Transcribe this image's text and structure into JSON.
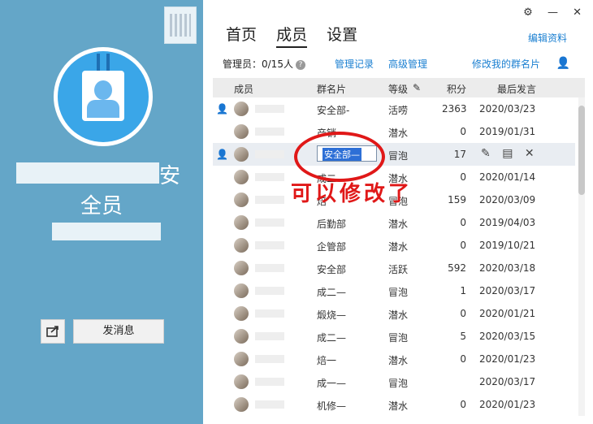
{
  "sidebar": {
    "group_name_visible_part": "安",
    "group_role": "全员",
    "send_message_label": "发消息"
  },
  "window": {
    "icons": [
      "settings-icon",
      "minimize-icon",
      "close-icon"
    ]
  },
  "tabs": [
    {
      "label": "首页",
      "active": false
    },
    {
      "label": "成员",
      "active": true
    },
    {
      "label": "设置",
      "active": false
    }
  ],
  "edit_profile_label": "编辑资料",
  "meta": {
    "admins_label": "管理员：0/15人",
    "manage_log": "管理记录",
    "advanced_manage": "高级管理",
    "edit_my_card": "修改我的群名片"
  },
  "table": {
    "headers": {
      "member": "成员",
      "card": "群名片",
      "level": "等级",
      "points": "积分",
      "last_msg": "最后发言"
    },
    "rows": [
      {
        "card": "安全部-",
        "level": "活唠",
        "points": "2363",
        "date": "2020/03/23"
      },
      {
        "card": "产销",
        "level": "潜水",
        "points": "0",
        "date": "2019/01/31"
      },
      {
        "card": "安全部—",
        "level": "冒泡",
        "points": "17",
        "date": "",
        "editing": true
      },
      {
        "card": "成二",
        "level": "潜水",
        "points": "0",
        "date": "2020/01/14"
      },
      {
        "card": "焙",
        "level": "冒泡",
        "points": "159",
        "date": "2020/03/09"
      },
      {
        "card": "后勤部",
        "level": "潜水",
        "points": "0",
        "date": "2019/04/03"
      },
      {
        "card": "企管部",
        "level": "潜水",
        "points": "0",
        "date": "2019/10/21"
      },
      {
        "card": "安全部",
        "level": "活跃",
        "points": "592",
        "date": "2020/03/18"
      },
      {
        "card": "成二—",
        "level": "冒泡",
        "points": "1",
        "date": "2020/03/17"
      },
      {
        "card": "煅烧—",
        "level": "潜水",
        "points": "0",
        "date": "2020/01/21"
      },
      {
        "card": "成二—",
        "level": "冒泡",
        "points": "5",
        "date": "2020/03/15"
      },
      {
        "card": "焙一",
        "level": "潜水",
        "points": "0",
        "date": "2020/01/23"
      },
      {
        "card": "成一—",
        "level": "冒泡",
        "points": "",
        "date": "2020/03/17"
      },
      {
        "card": "机修—",
        "level": "潜水",
        "points": "0",
        "date": "2020/01/23"
      }
    ]
  },
  "annotation": {
    "text": "可以修改了",
    "color": "#e01818"
  }
}
